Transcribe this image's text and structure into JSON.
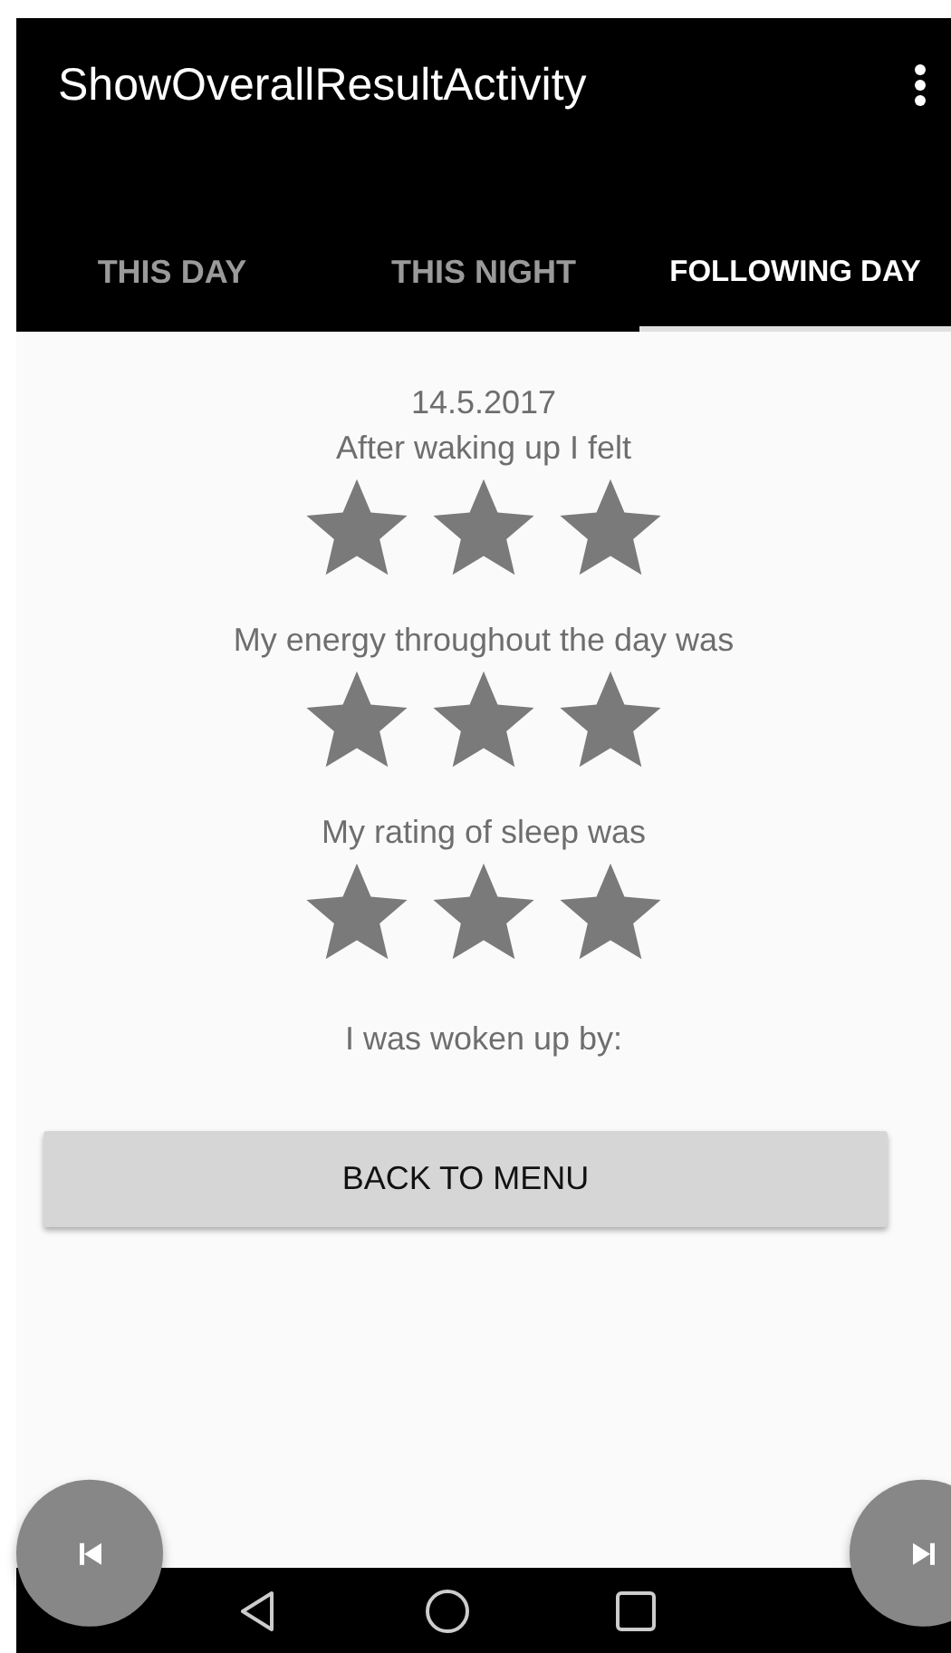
{
  "app_bar": {
    "title": "ShowOverallResultActivity"
  },
  "tabs": [
    {
      "label": "THIS DAY",
      "selected": false
    },
    {
      "label": "THIS NIGHT",
      "selected": false
    },
    {
      "label": "FOLLOWING DAY",
      "selected": true
    }
  ],
  "date": "14.5.2017",
  "ratings": [
    {
      "label": "After waking up I felt",
      "stars": 3
    },
    {
      "label": "My energy throughout the day was",
      "stars": 3
    },
    {
      "label": "My rating of sleep was",
      "stars": 3
    }
  ],
  "woken_up_label": "I was woken up by:",
  "back_button": "BACK TO MENU"
}
